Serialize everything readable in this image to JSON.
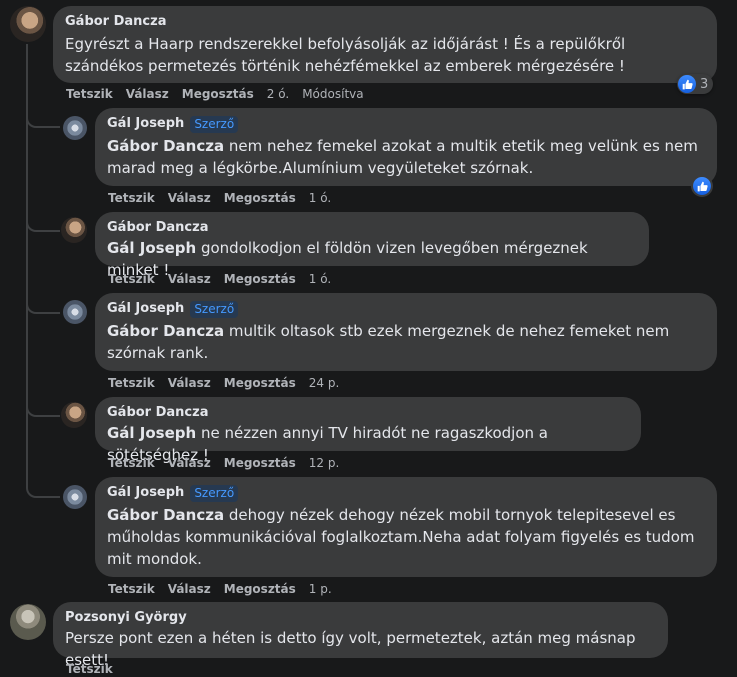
{
  "actions": {
    "like": "Tetszik",
    "reply": "Válasz",
    "share": "Megosztás",
    "edited": "Módosítva"
  },
  "comments": [
    {
      "author": "Gábor Dancza",
      "text": "Egyrészt a Haarp rendszerekkel befolyásolják az időjárást ! És a repülőkről szándékos permetezés történik nehézfémekkel az emberek mérgezésére !",
      "time": "2 ó.",
      "likes": "3"
    },
    {
      "author": "Gál Joseph",
      "badge": "Szerző",
      "mention": "Gábor Dancza",
      "text": " nem nehez femekel azokat a multik etetik meg velünk es nem marad meg a légkörbe.Alumínium vegyületeket szórnak.",
      "time": "1 ó."
    },
    {
      "author": "Gábor Dancza",
      "mention": "Gál Joseph",
      "text": " gondolkodjon el földön vizen levegőben mérgeznek minket !",
      "time": "1 ó."
    },
    {
      "author": "Gál Joseph",
      "badge": "Szerző",
      "mention": "Gábor Dancza",
      "text": " multik oltasok stb ezek mergeznek de nehez femeket nem szórnak rank.",
      "time": "24 p."
    },
    {
      "author": "Gábor Dancza",
      "mention": "Gál Joseph",
      "text": " ne nézzen annyi TV hiradót ne ragaszkodjon a sötétséghez !",
      "time": "12 p."
    },
    {
      "author": "Gál Joseph",
      "badge": "Szerző",
      "mention": "Gábor Dancza",
      "text": " dehogy nézek dehogy nézek mobil tornyok telepitesevel es műholdas kommunikációval foglalkoztam.Neha adat folyam figyelés es tudom mit mondok.",
      "time": "1 p."
    },
    {
      "author": "Pozsonyi György",
      "text": "Persze pont ezen a héten is detto így volt, permeteztek, aztán meg másnap esett!"
    }
  ],
  "colors": {
    "background": "#18191a",
    "bubble": "#3a3b3c",
    "text": "#e4e6eb",
    "meta": "#b0b3b8",
    "badge": "#4599ff",
    "like": "#1877f2"
  }
}
